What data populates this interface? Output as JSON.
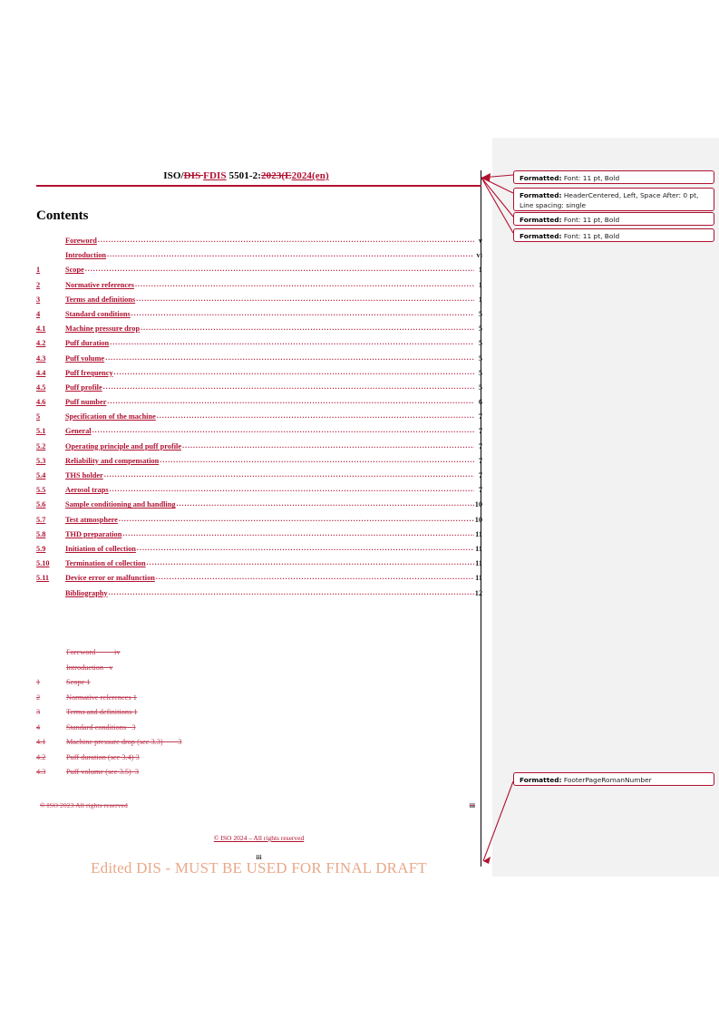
{
  "document": {
    "header": {
      "prefix": "ISO/",
      "deleted_1": "DIS ",
      "inserted_1": "FDIS",
      "middle": " 5501-2:",
      "deleted_2": "2023(E",
      "inserted_2": "2024(en)"
    },
    "contents_heading": "Contents",
    "toc_new": [
      {
        "num": "",
        "label": "Foreword",
        "page": "v"
      },
      {
        "num": "",
        "label": "Introduction",
        "page": "vi"
      },
      {
        "num": "1",
        "label": "Scope",
        "page": "1"
      },
      {
        "num": "2",
        "label": "Normative references",
        "page": "1"
      },
      {
        "num": "3",
        "label": "Terms and definitions",
        "page": "1"
      },
      {
        "num": "4",
        "label": "Standard conditions",
        "page": "5"
      },
      {
        "num": "4.1",
        "label": "Machine pressure drop",
        "page": "5"
      },
      {
        "num": "4.2",
        "label": "Puff duration",
        "page": "5"
      },
      {
        "num": "4.3",
        "label": "Puff volume",
        "page": "5"
      },
      {
        "num": "4.4",
        "label": "Puff frequency",
        "page": "5"
      },
      {
        "num": "4.5",
        "label": "Puff profile",
        "page": "5"
      },
      {
        "num": "4.6",
        "label": "Puff number",
        "page": "6"
      },
      {
        "num": "5",
        "label": "Specification of the machine",
        "page": "7"
      },
      {
        "num": "5.1",
        "label": "General",
        "page": "7"
      },
      {
        "num": "5.2",
        "label": "Operating principle and puff profile",
        "page": "7"
      },
      {
        "num": "5.3",
        "label": "Reliability and compensation",
        "page": "7"
      },
      {
        "num": "5.4",
        "label": "THS holder",
        "page": "7"
      },
      {
        "num": "5.5",
        "label": "Aerosol traps",
        "page": "7"
      },
      {
        "num": "5.6",
        "label": "Sample conditioning and handling",
        "page": "10"
      },
      {
        "num": "5.7",
        "label": "Test atmosphere",
        "page": "10"
      },
      {
        "num": "5.8",
        "label": "THD preparation",
        "page": "11"
      },
      {
        "num": "5.9",
        "label": "Initiation of collection",
        "page": "11"
      },
      {
        "num": "5.10",
        "label": "Termination of collection",
        "page": "11"
      },
      {
        "num": "5.11",
        "label": "Device error or malfunction",
        "page": "11"
      },
      {
        "num": "",
        "label": "Bibliography",
        "page": "12"
      }
    ],
    "toc_old": [
      {
        "num": "",
        "label": "Foreword",
        "gap": "          ",
        "page": "iv"
      },
      {
        "num": "",
        "label": "Introduction",
        "gap": "   ",
        "page": "v"
      },
      {
        "num": "1",
        "label": "Scope",
        "gap": " ",
        "page": "1"
      },
      {
        "num": "2",
        "label": "Normative references",
        "gap": " ",
        "page": "1"
      },
      {
        "num": "3",
        "label": "Terms and definitions",
        "gap": " ",
        "page": "1"
      },
      {
        "num": "4",
        "label": "Standard conditions",
        "gap": "   ",
        "page": "3"
      },
      {
        "num": "4.1",
        "label": "Machine pressure drop (see 3.3)",
        "gap": "        ",
        "page": "3"
      },
      {
        "num": "4.2",
        "label": "Puff duration (see 3.4)",
        "gap": " ",
        "page": "3"
      },
      {
        "num": "4.3",
        "label": "Puff volume (see 3.5)",
        "gap": "  ",
        "page": "3"
      }
    ],
    "footer_old_left": "© ISO 2023   All rights reserved",
    "footer_old_right": "iii",
    "footer_new_center": "© ISO 2024 – All rights reserved",
    "footer_page_number": "iii",
    "watermark": "Edited DIS - MUST BE USED FOR FINAL DRAFT"
  },
  "markup": {
    "balloons": [
      {
        "label": "Formatted:",
        "text": " Font: 11 pt, Bold"
      },
      {
        "label": "Formatted:",
        "text": " HeaderCentered, Left, Space After:  0 pt, Line spacing:  single"
      },
      {
        "label": "Formatted:",
        "text": " Font: 11 pt, Bold"
      },
      {
        "label": "Formatted:",
        "text": " Font: 11 pt, Bold"
      },
      {
        "label": "Formatted:",
        "text": " FooterPageRomanNumber"
      }
    ]
  },
  "colors": {
    "revision_red": "#B01030",
    "deleted_red": "#C04058",
    "markup_pane": "#f2f2f2",
    "watermark": "#E8A98A"
  }
}
